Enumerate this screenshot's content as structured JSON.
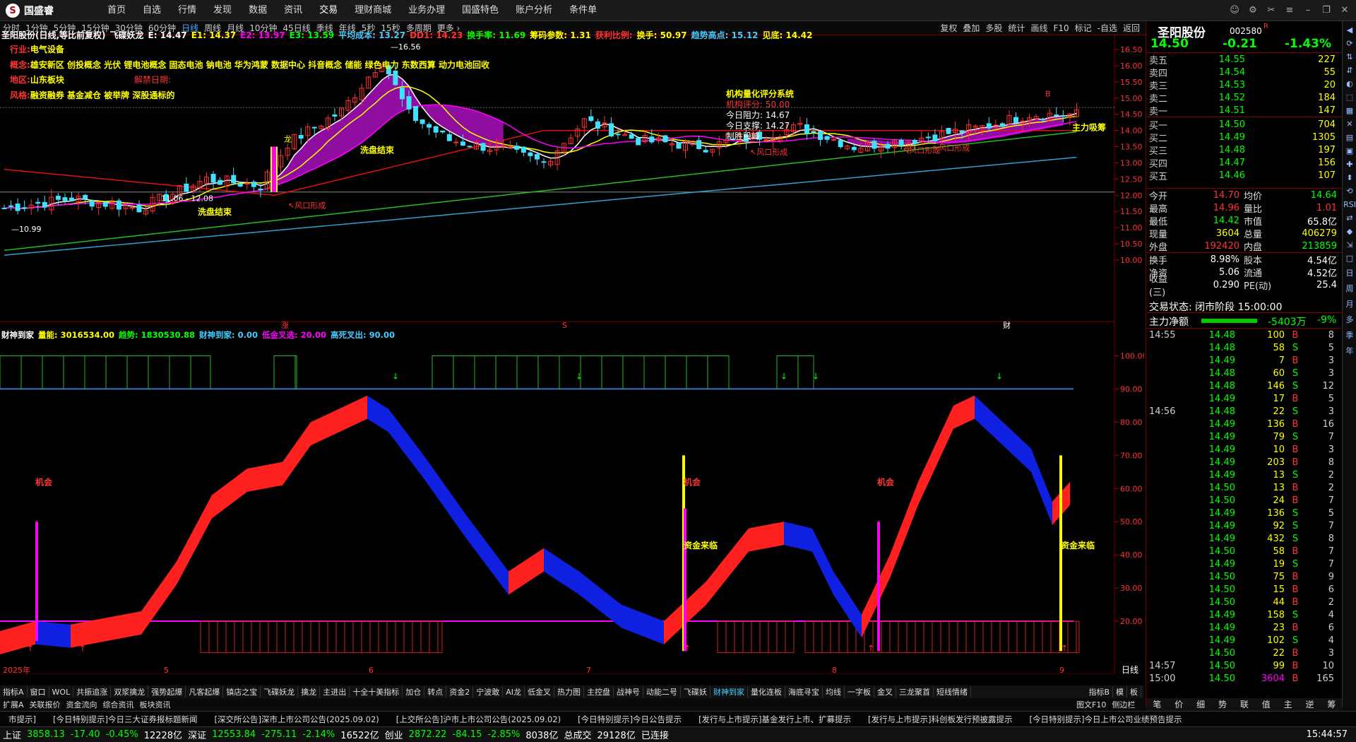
{
  "app": {
    "logo": "国盛睿",
    "logo_mark": "S"
  },
  "menu": [
    "首页",
    "自选",
    "行情",
    "发现",
    "数据",
    "资讯",
    "交易",
    "理财商城",
    "业务办理",
    "国盛特色",
    "账户分析",
    "条件单"
  ],
  "menu_active": 6,
  "window_buttons": [
    "chat-icon",
    "settings-icon",
    "tools-icon",
    "menu-icon",
    "minimize-icon",
    "restore-icon",
    "close-icon"
  ],
  "periods": [
    "分时",
    "1分钟",
    "5分钟",
    "15分钟",
    "30分钟",
    "60分钟",
    "日线",
    "周线",
    "月线",
    "10分钟",
    "45日线",
    "季线",
    "年线",
    "5秒",
    "15秒",
    "多周期",
    "更多 ›"
  ],
  "period_active": 6,
  "period_right": [
    "复权",
    "叠加",
    "多股",
    "统计",
    "画线",
    "F10",
    "标记",
    "-自选",
    "返回"
  ],
  "ma_line": [
    {
      "t": "圣阳股份(日线,等比前复权)",
      "c": "#fff"
    },
    {
      "t": "飞碟妖龙",
      "c": "#fff"
    },
    {
      "t": "E: 14.47",
      "c": "#fff"
    },
    {
      "t": "E1: 14.37",
      "c": "#ff0"
    },
    {
      "t": "E2: 13.97",
      "c": "#f0f"
    },
    {
      "t": "E3: 13.59",
      "c": "#0f0"
    },
    {
      "t": "平均成本: 13.27",
      "c": "#4cf"
    },
    {
      "t": "DD1: 14.23",
      "c": "#f33"
    },
    {
      "t": "换手率: 11.69",
      "c": "#0f0"
    },
    {
      "t": "筹码参数: 1.31",
      "c": "#ff0"
    },
    {
      "t": "获利比例:",
      "c": "#f33"
    },
    {
      "t": "换手: 50.97",
      "c": "#ff0"
    },
    {
      "t": "趋势高点: 15.12",
      "c": "#4cf"
    },
    {
      "t": "见底: 14.42",
      "c": "#ff0"
    }
  ],
  "info": [
    {
      "k": "行业:",
      "v": "电气设备"
    },
    {
      "k": "概念:",
      "v": "雄安新区 创投概念 光伏 锂电池概念 固态电池 钠电池 华为鸿蒙 数据中心 抖音概念 储能 绿色电力 东数西算 动力电池回收"
    },
    {
      "k": "地区:",
      "v": "山东板块"
    },
    {
      "k": "风格:",
      "v": "融资融券 基金减仓 被举牌 深股通标的"
    }
  ],
  "unlock_label": "解禁日期:",
  "main_axis": [
    "16.50",
    "16.00",
    "15.50",
    "15.00",
    "14.50",
    "14.00",
    "13.50",
    "13.00",
    "12.50",
    "12.00",
    "11.50",
    "11.00",
    "10.50",
    "10.00"
  ],
  "main_labels": {
    "high": "16.56",
    "low": "10.99",
    "range": "11.06 - 12.08",
    "wash1": "洗盘结束",
    "wash2": "洗盘结束",
    "wind1": "↖风口形成",
    "wind2": "↖风口形成",
    "wind3": "↖风口形成",
    "wind4": "↖风口形成",
    "zhuli": "主力吸筹",
    "dragon": "龙"
  },
  "system": {
    "title": "机构量化评分系统",
    "score": "机构评分: 50.00",
    "resist": "今日阻力: 14.67",
    "support": "今日支撑: 14.27",
    "ctrl": "控盘",
    "tail": "制胜股峰"
  },
  "date_marks": [
    "涨",
    "S",
    "财"
  ],
  "sub_header": [
    {
      "t": "财神到家",
      "c": "#fff"
    },
    {
      "t": "量能: 3016534.00",
      "c": "#ff0"
    },
    {
      "t": "趋势: 1830530.88",
      "c": "#0f0"
    },
    {
      "t": "财神到家: 0.00",
      "c": "#4cf"
    },
    {
      "t": "低金叉选: 20.00",
      "c": "#f0f"
    },
    {
      "t": "高死叉出: 90.00",
      "c": "#4cf"
    }
  ],
  "sub_axis": [
    "100.00",
    "90.00",
    "80.00",
    "70.00",
    "60.00",
    "50.00",
    "40.00",
    "30.00",
    "20.00"
  ],
  "sub_labels": {
    "jihui1": "机会",
    "jihui2": "机会",
    "jihui3": "机会",
    "zj1": "资金来临",
    "zj2": "资金来临"
  },
  "x_dates": [
    "2025年",
    "5",
    "6",
    "7",
    "8",
    "9"
  ],
  "x_period": "日线",
  "bottom_tabs": [
    "指标A",
    "窗口",
    "WOL",
    "共振追涨",
    "双浆擒龙",
    "强势起爆",
    "凡客起爆",
    "镇店之宝",
    "飞碟妖龙",
    "擒龙",
    "主进出",
    "十全十美指标",
    "加仓",
    "转点",
    "资金2",
    "宁波敢",
    "AI龙",
    "低金叉",
    "热力图",
    "主控盘",
    "战神号",
    "动能二号",
    "飞碟妖",
    "财神到家",
    "量化连板",
    "海底寻宝",
    "均线",
    "一字板",
    "金叉",
    "三龙聚首",
    "短线情绪"
  ],
  "bottom_right": [
    "指标B",
    "模",
    "板"
  ],
  "ext_tabs": [
    "扩展A",
    "关联报价",
    "资金流向",
    "综合资讯",
    "板块资讯"
  ],
  "ext_right": [
    "图文F10",
    "侧边栏"
  ],
  "ticker": [
    "市提示]",
    "[今日特别提示]今日三大证券报标题新闻",
    "[深交所公告]深市上市公司公告(2025.09.02)",
    "[上交所公告]沪市上市公司公告(2025.09.02)",
    "[今日特别提示]今日公告提示",
    "[发行与上市提示]基金发行上市、扩募提示",
    "[发行与上市提示]科创板发行预披露提示",
    "[今日特别提示]今日上市公司业绩预告提示"
  ],
  "status": [
    {
      "t": "上证",
      "c": "#fff"
    },
    {
      "t": "3858.13",
      "c": "#0f0"
    },
    {
      "t": "-17.40",
      "c": "#0f0"
    },
    {
      "t": "-0.45%",
      "c": "#0f0"
    },
    {
      "t": "12228亿",
      "c": "#fff"
    },
    {
      "t": "深证",
      "c": "#fff"
    },
    {
      "t": "12553.84",
      "c": "#0f0"
    },
    {
      "t": "-275.11",
      "c": "#0f0"
    },
    {
      "t": "-2.14%",
      "c": "#0f0"
    },
    {
      "t": "16522亿",
      "c": "#fff"
    },
    {
      "t": "创业",
      "c": "#fff"
    },
    {
      "t": "2872.22",
      "c": "#0f0"
    },
    {
      "t": "-84.15",
      "c": "#0f0"
    },
    {
      "t": "-2.85%",
      "c": "#0f0"
    },
    {
      "t": "8038亿",
      "c": "#fff"
    },
    {
      "t": "总成交",
      "c": "#fff"
    },
    {
      "t": "29128亿",
      "c": "#fff"
    },
    {
      "t": "已连接",
      "c": "#fff"
    }
  ],
  "clock": "15:44:57",
  "stock": {
    "name": "圣阳股份",
    "code": "002580",
    "flag": "R",
    "price": "14.50",
    "change": "-0.21",
    "pct": "-1.43%"
  },
  "asks": [
    {
      "n": "卖五",
      "p": "14.55",
      "v": "227"
    },
    {
      "n": "卖四",
      "p": "14.54",
      "v": "55"
    },
    {
      "n": "卖三",
      "p": "14.53",
      "v": "20"
    },
    {
      "n": "卖二",
      "p": "14.52",
      "v": "184"
    },
    {
      "n": "卖一",
      "p": "14.51",
      "v": "147"
    }
  ],
  "bids": [
    {
      "n": "买一",
      "p": "14.50",
      "v": "704"
    },
    {
      "n": "买二",
      "p": "14.49",
      "v": "1305"
    },
    {
      "n": "买三",
      "p": "14.48",
      "v": "197"
    },
    {
      "n": "买四",
      "p": "14.47",
      "v": "156"
    },
    {
      "n": "买五",
      "p": "14.46",
      "v": "107"
    }
  ],
  "stats": [
    [
      "今开",
      "14.70",
      "均价",
      "14.64"
    ],
    [
      "最高",
      "14.96",
      "量比",
      "1.01"
    ],
    [
      "最低",
      "14.42",
      "市值",
      "65.8亿"
    ],
    [
      "现量",
      "3604",
      "总量",
      "406279"
    ],
    [
      "外盘",
      "192420",
      "内盘",
      "213859"
    ],
    [
      "换手",
      "8.98%",
      "股本",
      "4.54亿"
    ],
    [
      "净资",
      "5.06",
      "流通",
      "4.52亿"
    ],
    [
      "收益(三)",
      "0.290",
      "PE(动)",
      "25.4"
    ]
  ],
  "trade_state": "交易状态: 闭市阶段 15:00:00",
  "main_net": {
    "label": "主力净额",
    "value": "-5403万",
    "pct": "-9%",
    "bar_fraction": 0.45
  },
  "ticks": [
    [
      "14:55",
      "14.48",
      "100",
      "B",
      "8"
    ],
    [
      "",
      "14.48",
      "58",
      "S",
      "5"
    ],
    [
      "",
      "14.49",
      "7",
      "B",
      "3"
    ],
    [
      "",
      "14.48",
      "60",
      "S",
      "3"
    ],
    [
      "",
      "14.48",
      "146",
      "S",
      "12"
    ],
    [
      "",
      "14.49",
      "17",
      "B",
      "5"
    ],
    [
      "14:56",
      "14.48",
      "22",
      "S",
      "3"
    ],
    [
      "",
      "14.49",
      "136",
      "B",
      "16"
    ],
    [
      "",
      "14.49",
      "79",
      "S",
      "7"
    ],
    [
      "",
      "14.49",
      "10",
      "B",
      "3"
    ],
    [
      "",
      "14.49",
      "203",
      "B",
      "8"
    ],
    [
      "",
      "14.49",
      "13",
      "S",
      "2"
    ],
    [
      "",
      "14.50",
      "13",
      "B",
      "2"
    ],
    [
      "",
      "14.50",
      "24",
      "B",
      "7"
    ],
    [
      "",
      "14.49",
      "136",
      "S",
      "5"
    ],
    [
      "",
      "14.49",
      "92",
      "S",
      "7"
    ],
    [
      "",
      "14.49",
      "432",
      "S",
      "8"
    ],
    [
      "",
      "14.50",
      "58",
      "B",
      "7"
    ],
    [
      "",
      "14.49",
      "19",
      "S",
      "7"
    ],
    [
      "",
      "14.50",
      "75",
      "B",
      "9"
    ],
    [
      "",
      "14.50",
      "15",
      "B",
      "6"
    ],
    [
      "",
      "14.50",
      "44",
      "B",
      "2"
    ],
    [
      "",
      "14.49",
      "158",
      "S",
      "4"
    ],
    [
      "",
      "14.49",
      "23",
      "B",
      "6"
    ],
    [
      "",
      "14.49",
      "102",
      "S",
      "4"
    ],
    [
      "",
      "14.50",
      "22",
      "B",
      "3"
    ],
    [
      "14:57",
      "14.50",
      "99",
      "B",
      "10"
    ],
    [
      "15:00",
      "14.50",
      "3604",
      "B",
      "165"
    ]
  ],
  "rp_tabs": [
    "笔",
    "价",
    "细",
    "势",
    "联",
    "值",
    "主",
    "逆",
    "筹"
  ],
  "sidebar": [
    "◀",
    "⟳",
    "⇅",
    "⇵",
    "◐",
    "⬚",
    "▦",
    "✕",
    "▤",
    "▣",
    "✚",
    "⬍",
    "⟲",
    "RSI",
    "⇄",
    "◆",
    "⇲",
    "□",
    "日",
    "周",
    "月",
    "多",
    "季",
    "年"
  ],
  "chart_data": {
    "type": "candlestick",
    "price_axis": [
      10.0,
      16.5
    ],
    "annotations": {
      "high": 16.56,
      "low": 10.99
    },
    "indicator": {
      "name": "财神到家",
      "axis": [
        20,
        100
      ],
      "low_cross": 20,
      "high_cross": 90
    }
  }
}
